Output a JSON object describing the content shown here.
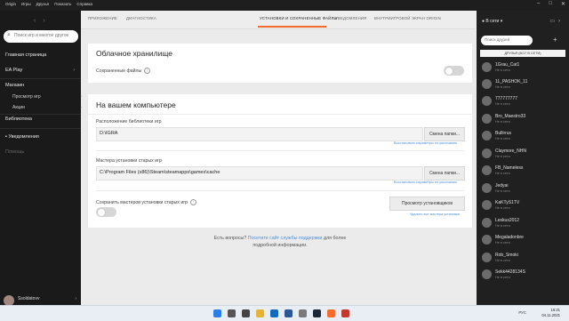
{
  "menubar": {
    "items": [
      "Origin",
      "Игры",
      "Друзья",
      "Показать",
      "Справка"
    ]
  },
  "sidebar": {
    "search_placeholder": "Поиск игр и многое другое",
    "home": "Главная страница",
    "ea_play": "EA Play",
    "store": "Магазин",
    "browse_games": "Просмотр игр",
    "deals": "Акции",
    "library": "Библиотека",
    "notifications": "Уведомления",
    "help": "Помощь",
    "username": "Ssoldatovv"
  },
  "tabs": [
    {
      "label": "ПРИЛОЖЕНИЕ"
    },
    {
      "label": "ДИАГНОСТИКА"
    },
    {
      "label": "УСТАНОВКИ И СОХРАНЕННЫЕ ФАЙЛЫ"
    },
    {
      "label": "УВЕДОМЛЕНИЯ"
    },
    {
      "label": "ВНУТРИИГРОВОЙ ЭКРАН ORIGIN"
    }
  ],
  "active_tab": "УСТАНОВКИ И СОХРАНЕННЫЕ ФАЙЛЫ",
  "cloud": {
    "title": "Облачное хранилище",
    "saves_label": "Сохраненные файлы",
    "saves_enabled": false
  },
  "local": {
    "title": "На вашем компьютере",
    "library_label": "Расположение библиотеки игр",
    "library_path": "D:\\IGRA",
    "change_folder": "Смена папки...",
    "reset_defaults": "Восстановить параметры по умолчанию",
    "legacy_label": "Мастера установки старых игр",
    "legacy_path": "C:\\Program Files (x86)\\Steam\\steamapps\\games\\cache",
    "keep_installers_label": "Сохранить мастеров установки старых игр",
    "keep_installers_enabled": false,
    "view_installers": "Просмотр установщиков",
    "delete_installers": "Удалить все мастера установки"
  },
  "help_text": {
    "prefix": "Есть вопросы?",
    "link": "Посетите сайт службы поддержки",
    "suffix": "для более подробной информации."
  },
  "friends": {
    "status": "В сети",
    "search_placeholder": "Поиск друзей",
    "header": "ДРУЗЬЯ (В/17 В СЕТИ)",
    "list": [
      {
        "name": "1Grau_Cat1",
        "state": "Не в сети"
      },
      {
        "name": "11_PASHOK_11",
        "state": "Не в сети"
      },
      {
        "name": "777777777",
        "state": "Не в сети"
      },
      {
        "name": "Bro_Maestro33",
        "state": "Не в сети"
      },
      {
        "name": "Bullirrus",
        "state": "Не в сети"
      },
      {
        "name": "Claymore_NHN",
        "state": "Не в сети"
      },
      {
        "name": "FB_Nameless",
        "state": "Не в сети"
      },
      {
        "name": "Jedyai",
        "state": "Не в сети"
      },
      {
        "name": "KaKTyS1TV",
        "state": "Не в сети"
      },
      {
        "name": "Leskus2012",
        "state": "Не в сети"
      },
      {
        "name": "Megaladonbre",
        "state": "Не в сети"
      },
      {
        "name": "Rob_Smoki",
        "state": "Не в сети"
      },
      {
        "name": "Sekk4428134S",
        "state": "Не в сети"
      }
    ]
  },
  "taskbar": {
    "lang": "РУС",
    "time": "16:21",
    "date": "04.11.2021"
  },
  "colors": {
    "accent": "#f56c2d",
    "link": "#4a90d9",
    "sidebar": "#1a1a1a"
  }
}
